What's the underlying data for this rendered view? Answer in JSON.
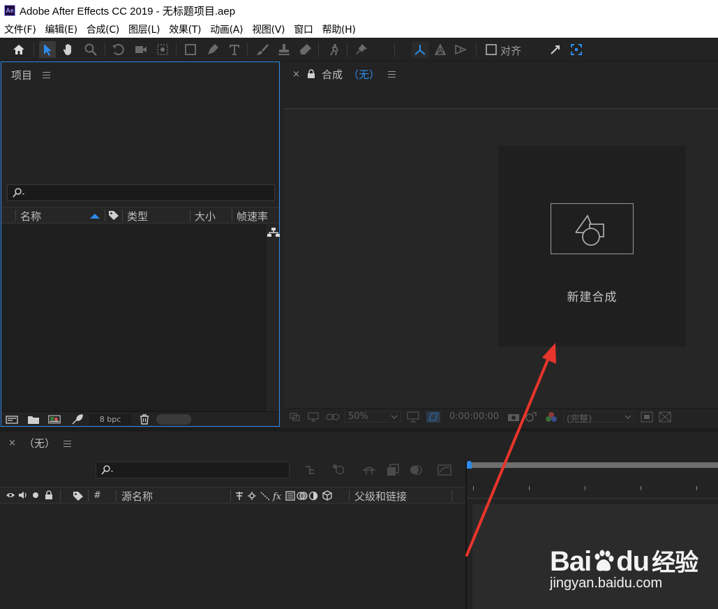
{
  "window": {
    "title": "Adobe After Effects CC 2019 - 无标题项目.aep",
    "app_icon_text": "Ae"
  },
  "menu": [
    "文件(F)",
    "编辑(E)",
    "合成(C)",
    "图层(L)",
    "效果(T)",
    "动画(A)",
    "视图(V)",
    "窗口",
    "帮助(H)"
  ],
  "toolbar": {
    "align_label": "对齐",
    "icons": [
      "home-icon",
      "selection-arrow-icon",
      "hand-icon",
      "zoom-icon",
      "rotate-icon",
      "camera-icon",
      "pan-behind-icon",
      "rectangle-icon",
      "pen-icon",
      "text-icon",
      "brush-icon",
      "clone-stamp-icon",
      "eraser-icon",
      "roto-brush-icon",
      "puppet-pin-icon",
      "local-axis-icon",
      "world-axis-icon",
      "view-axis-icon",
      "snapping-icon",
      "snap-extend-icon"
    ]
  },
  "project": {
    "title": "项目",
    "columns": {
      "name": "名称",
      "type": "类型",
      "size": "大小",
      "fps": "帧速率"
    },
    "bpc": "8 bpc"
  },
  "composition": {
    "close": "×",
    "title": "合成",
    "name": "（无）",
    "new_comp_label": "新建合成",
    "zoom": "50%",
    "timecode": "0:00:00:00",
    "resolution": "(完整)"
  },
  "timeline": {
    "close": "×",
    "name": "（无）",
    "columns": {
      "hash": "#",
      "source_name": "源名称",
      "parent": "父级和链接"
    }
  },
  "watermark": {
    "logo_a": "Bai",
    "logo_b": "du",
    "logo_c": "经验",
    "url": "jingyan.baidu.com"
  },
  "colors": {
    "accent": "#2d8ceb",
    "arrow": "#e8352b"
  }
}
